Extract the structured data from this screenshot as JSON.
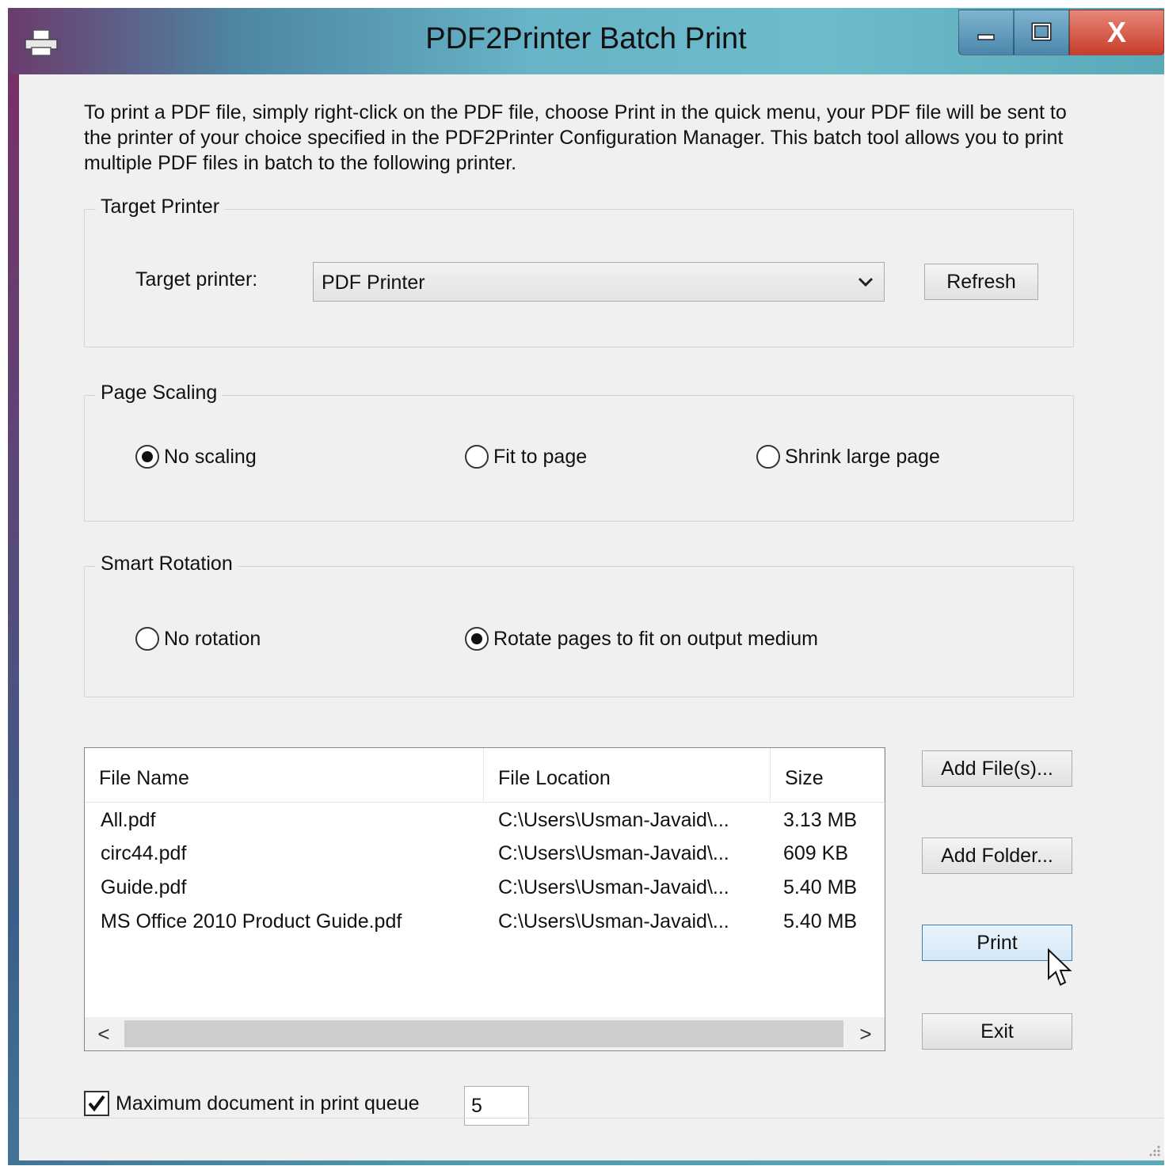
{
  "window": {
    "title": "PDF2Printer Batch Print",
    "controls": {
      "minimize": "minimize-icon",
      "maximize": "maximize-icon",
      "close": "X"
    }
  },
  "intro_text": "To print a PDF file, simply right-click on the PDF file, choose Print in the quick menu, your PDF file will be sent to the printer of your choice specified in the PDF2Printer Configuration Manager. This batch tool allows you to print multiple PDF files in batch to the following printer.",
  "target_printer": {
    "group_label": "Target Printer",
    "field_label": "Target printer:",
    "selected": "PDF Printer",
    "refresh_label": "Refresh"
  },
  "page_scaling": {
    "group_label": "Page Scaling",
    "options": [
      {
        "label": "No scaling",
        "checked": true
      },
      {
        "label": "Fit to page",
        "checked": false
      },
      {
        "label": "Shrink large page",
        "checked": false
      }
    ]
  },
  "smart_rotation": {
    "group_label": "Smart Rotation",
    "options": [
      {
        "label": "No rotation",
        "checked": false
      },
      {
        "label": "Rotate pages to fit on output medium",
        "checked": true
      }
    ]
  },
  "file_list": {
    "columns": [
      "File Name",
      "File Location",
      "Size"
    ],
    "rows": [
      {
        "name": "All.pdf",
        "location": "C:\\Users\\Usman-Javaid\\...",
        "size": "3.13 MB"
      },
      {
        "name": "circ44.pdf",
        "location": "C:\\Users\\Usman-Javaid\\...",
        "size": "609 KB"
      },
      {
        "name": "Guide.pdf",
        "location": "C:\\Users\\Usman-Javaid\\...",
        "size": "5.40 MB"
      },
      {
        "name": "MS Office 2010 Product Guide.pdf",
        "location": "C:\\Users\\Usman-Javaid\\...",
        "size": "5.40 MB"
      }
    ],
    "scroll_left": "<",
    "scroll_right": ">"
  },
  "actions": {
    "add_files": "Add File(s)...",
    "add_folder": "Add Folder...",
    "print": "Print",
    "exit": "Exit"
  },
  "queue": {
    "label": "Maximum document in print queue",
    "checked": true,
    "value": "5"
  },
  "colors": {
    "client_bg": "#f0f0f0",
    "close_red": "#c73c2a",
    "focus_blue": "#3c7fb1"
  }
}
